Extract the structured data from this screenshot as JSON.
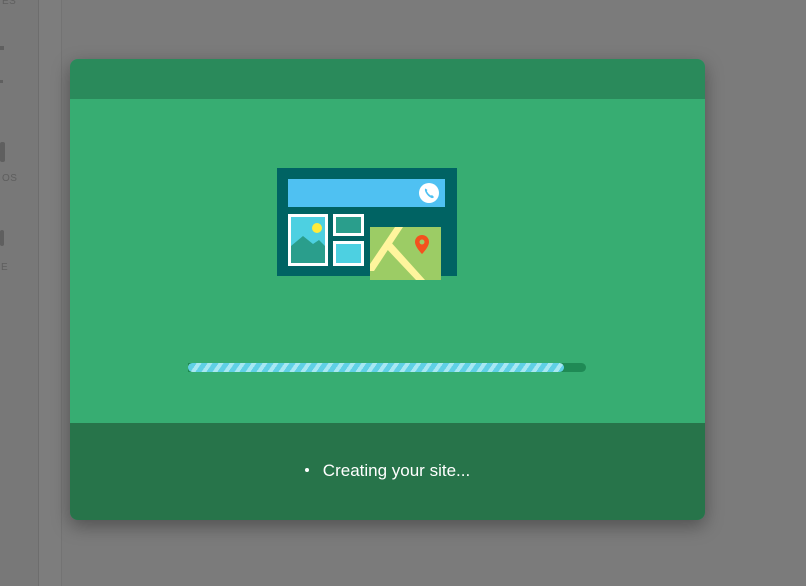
{
  "background": {
    "rail_labels": [
      "ES",
      "OS",
      "E"
    ]
  },
  "dialog": {
    "status_text": "Creating your site...",
    "progress_fraction": 0.945
  },
  "icons": {
    "phone": "phone-icon",
    "image": "image-icon",
    "map_pin": "map-pin-icon"
  },
  "colors": {
    "header": "#2a8a5b",
    "body": "#37ad72",
    "footer": "#27744a",
    "progress_fill": "#5fd0e6",
    "progress_track": "#1f8a55"
  }
}
